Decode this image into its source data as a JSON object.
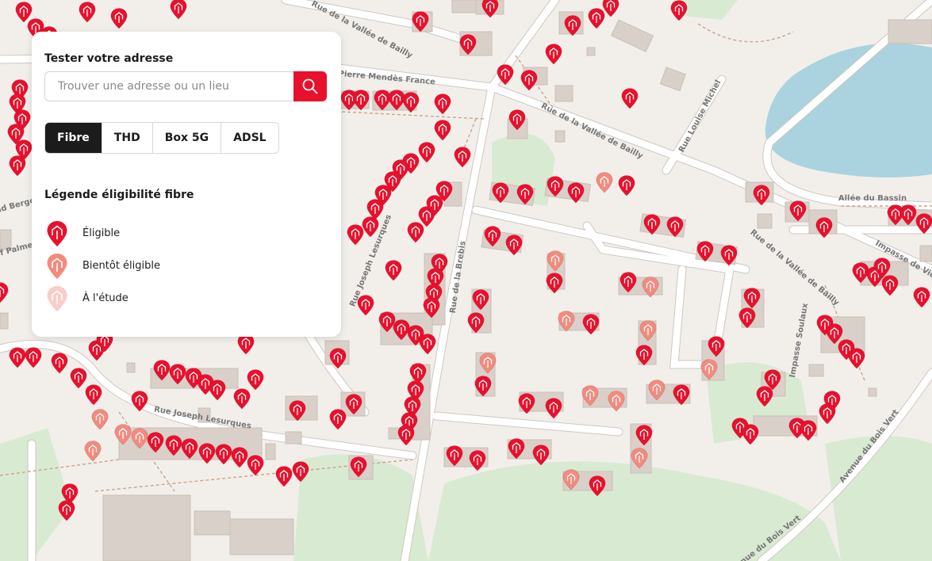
{
  "panel": {
    "title": "Tester votre adresse",
    "search_placeholder": "Trouver une adresse ou un lieu",
    "tabs": [
      {
        "label": "Fibre",
        "active": true
      },
      {
        "label": "THD",
        "active": false
      },
      {
        "label": "Box 5G",
        "active": false
      },
      {
        "label": "ADSL",
        "active": false
      }
    ],
    "legend_title": "Légende éligibilité fibre",
    "legend": [
      {
        "label": "Éligible",
        "color": "#e8112d"
      },
      {
        "label": "Bientôt éligible",
        "color": "#f28b7e"
      },
      {
        "label": "À l'étude",
        "color": "#f9cdc8"
      }
    ]
  },
  "map": {
    "colors": {
      "background": "#f2efeb",
      "road": "#ffffff",
      "building": "#d9d0c9",
      "water": "#aad3df",
      "park": "#d7e8cf",
      "path": "#c8a48a"
    },
    "streets": [
      "Rue de la Vallée de Bailly",
      "Rue Pierre Mendès France",
      "Rue de la Vallée de Bailly",
      "Rue Louise Michel",
      "Allée du Bassin",
      "Rue de la Vallée de Bailly",
      "Impasse de Vie",
      "Rue Joseph Lesurques",
      "Rue de la Brebis",
      "Impasse Soulaux",
      "Rue Joseph Lesurques",
      "Avenue du Bois Vert",
      "Avenue du Bois Vert",
      "nd Berge",
      "uf Palme"
    ]
  }
}
